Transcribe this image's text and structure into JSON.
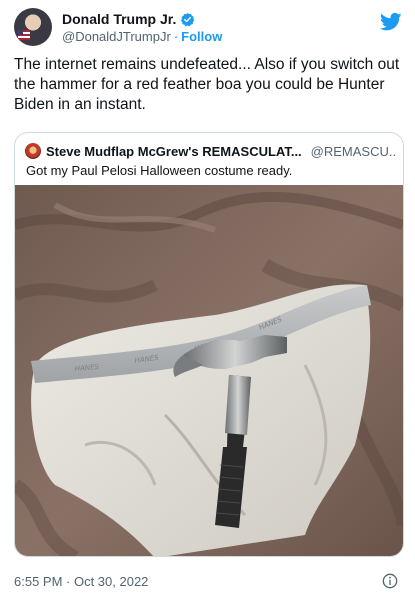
{
  "author": {
    "name": "Donald Trump Jr.",
    "handle": "@DonaldJTrumpJr",
    "separator": "·",
    "follow_label": "Follow"
  },
  "tweet": {
    "text": "The internet remains undefeated... Also if you switch out the hammer for a red feather boa you could be Hunter Biden in an instant.",
    "timestamp": "6:55 PM · Oct 30, 2022"
  },
  "quoted": {
    "name": "Steve Mudflap McGrew's REMASCULAT...",
    "handle": "@REMASCU...",
    "text": "Got my Paul Pelosi Halloween costume ready.",
    "waistband_text": "HANES"
  },
  "icons": {
    "verified": "verified-badge-icon",
    "platform": "twitter-bird-icon",
    "info": "info-icon"
  },
  "colors": {
    "accent": "#1d9bf0",
    "text": "#0f1419",
    "secondary": "#536471",
    "border": "#cfd9de"
  }
}
